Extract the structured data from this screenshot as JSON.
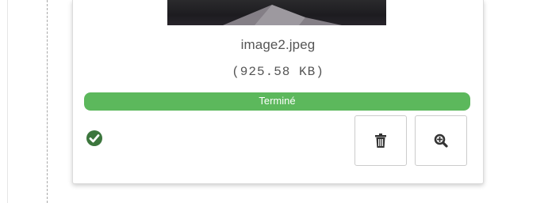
{
  "file": {
    "name": "image2.jpeg",
    "size": "(925.58 KB)",
    "progress": {
      "value": 1.0,
      "label": "Terminé"
    }
  },
  "icons": {
    "status": "check-circle-icon",
    "delete": "trash-icon",
    "zoom": "zoom-in-icon"
  },
  "colors": {
    "success": "#5cb85c",
    "status_icon": "#3c763d",
    "text": "#555555"
  }
}
